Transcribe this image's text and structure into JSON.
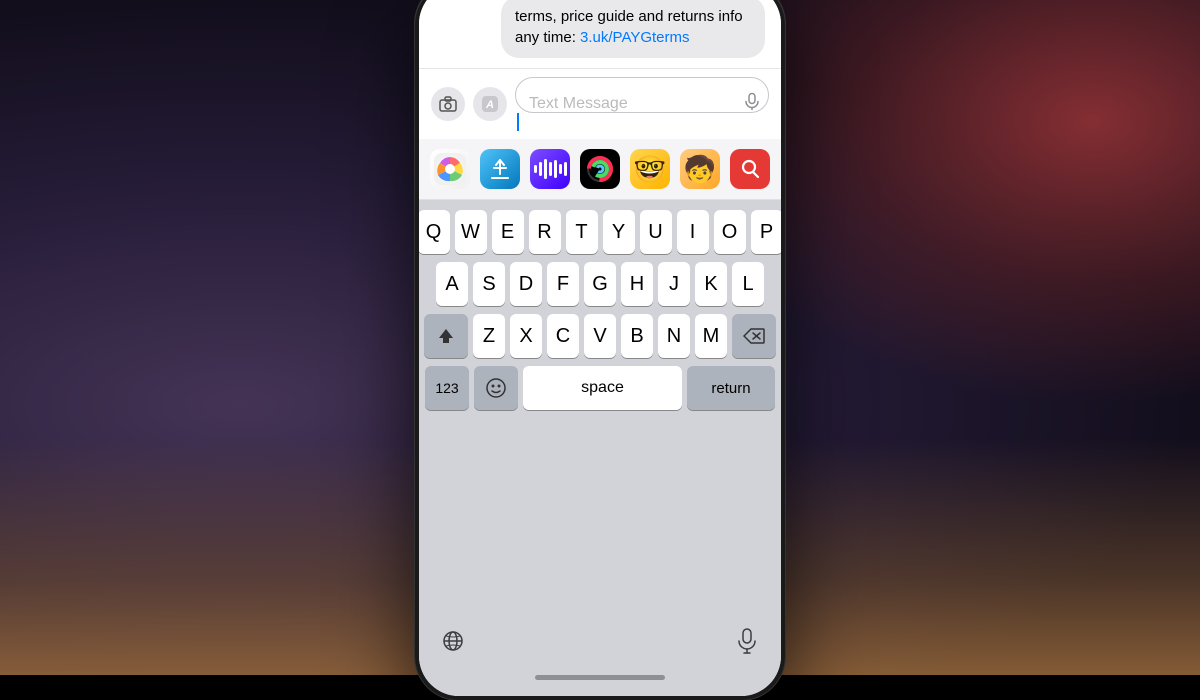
{
  "background": {
    "description": "blurred bokeh background with purple left and red right and wooden surface bottom"
  },
  "phone": {
    "message": {
      "text": "terms, price guide and returns info any time:",
      "link": "3.uk/PAYGterms"
    },
    "input_bar": {
      "placeholder": "Text Message",
      "camera_label": "camera",
      "appstore_label": "appstore",
      "mic_label": "microphone"
    },
    "app_shortcuts": [
      {
        "name": "Photos",
        "icon": "🌅"
      },
      {
        "name": "App Store",
        "icon": "A"
      },
      {
        "name": "SoundCloud",
        "icon": "soundwave"
      },
      {
        "name": "Activity",
        "icon": "rings"
      },
      {
        "name": "Memoji 1",
        "icon": "🤓"
      },
      {
        "name": "Memoji 2",
        "icon": "🧒"
      },
      {
        "name": "Search",
        "icon": "🔍"
      }
    ],
    "keyboard": {
      "rows": [
        [
          "Q",
          "W",
          "E",
          "R",
          "T",
          "Y",
          "U",
          "I",
          "O",
          "P"
        ],
        [
          "A",
          "S",
          "D",
          "F",
          "G",
          "H",
          "J",
          "K",
          "L"
        ],
        [
          "⇧",
          "Z",
          "X",
          "C",
          "V",
          "B",
          "N",
          "M",
          "⌫"
        ],
        [
          "123",
          "😊",
          "space",
          "return"
        ]
      ],
      "space_label": "space",
      "return_label": "return",
      "numbers_label": "123",
      "shift_label": "⇧",
      "backspace_label": "⌫"
    },
    "bottom_bar": {
      "globe_icon": "🌐",
      "mic_icon": "🎤"
    },
    "home_indicator": "─"
  }
}
